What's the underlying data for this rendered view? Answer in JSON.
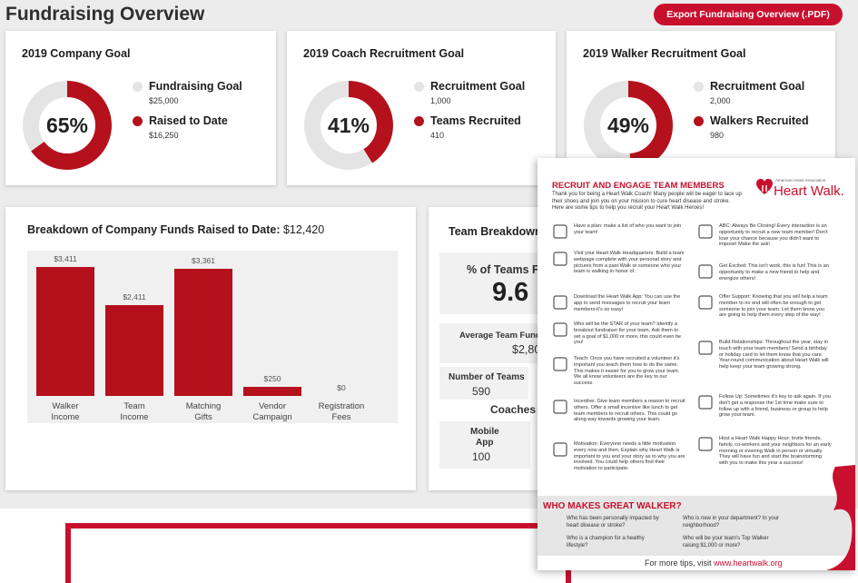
{
  "page": {
    "title": "Fundraising Overview",
    "export_label": "Export Fundraising Overview (.PDF)"
  },
  "goals": [
    {
      "title": "2019 Company Goal",
      "percent_label": "65%",
      "percent": 0.65,
      "goal_label": "Fundraising Goal",
      "goal_value": "$25,000",
      "done_label": "Raised to Date",
      "done_value": "$16,250"
    },
    {
      "title": "2019 Coach Recruitment Goal",
      "percent_label": "41%",
      "percent": 0.41,
      "goal_label": "Recruitment Goal",
      "goal_value": "1,000",
      "done_label": "Teams Recruited",
      "done_value": "410"
    },
    {
      "title": "2019 Walker Recruitment Goal",
      "percent_label": "49%",
      "percent": 0.49,
      "goal_label": "Recruitment Goal",
      "goal_value": "2,000",
      "done_label": "Walkers Recruited",
      "done_value": "980"
    }
  ],
  "breakdown": {
    "title_prefix": "Breakdown of Company Funds Raised to Date: ",
    "title_total": "$12,420"
  },
  "chart_data": {
    "type": "bar",
    "title": "Breakdown of Company Funds Raised to Date: $12,420",
    "categories": [
      "Walker Income",
      "Team Income",
      "Matching Gifts",
      "Vendor Campaign",
      "Registration Fees"
    ],
    "category_lines": [
      [
        "Walker",
        "Income"
      ],
      [
        "Team",
        "Income"
      ],
      [
        "Matching",
        "Gifts"
      ],
      [
        "Vendor",
        "Campaign"
      ],
      [
        "Registration",
        "Fees"
      ]
    ],
    "values": [
      3411,
      2411,
      3361,
      250,
      0
    ],
    "value_labels": [
      "$3,411",
      "$2,411",
      "$3,361",
      "$250",
      "$0"
    ],
    "ylim": [
      0,
      3600
    ],
    "grid": false,
    "bar_color": "#b4111d"
  },
  "team_breakdown": {
    "title": "Team Breakdown",
    "pct_label": "% of Teams Fu",
    "pct_value": "9.6",
    "avg_label": "Average Team Fundr",
    "avg_value": "$2,80",
    "num_teams_label": "Number of Teams",
    "num_teams_value": "590",
    "coaches_label": "Coaches",
    "mobile_label_1": "Mobile",
    "mobile_label_2": "App",
    "mobile_value": "100"
  },
  "flyer": {
    "heading": "RECRUIT AND ENGAGE TEAM MEMBERS",
    "intro": "Thank you for being a Heart Walk Coach! Many people will be eager to lace up their shoes and join you on your mission to cure heart disease and stroke. Here are some tips to help you recruit your Heart Walk Heroes!",
    "logo_small": "American Heart Association.",
    "logo_big": "Heart Walk.",
    "tips_left": [
      "Have a plan: make a list of who you want to join your team!",
      "Visit your Heart Walk Headquarters: Build a team webpage complete with your personal story and pictures from a past Walk or someone who your team is walking in honor of.",
      "Download the Heart Walk App: You can use the app to send messages to recruit your team members-it's so easy!",
      "Who will be the STAR of your team? Identify a breakout fundraiser for your team. Ask them to set a goal of $1,000 or more, this could even be you!",
      "Teach: Once you have recruited a volunteer it's important you teach them how to do the same. This makes it easier for you to grow your team. We all know volunteers are the key to our success.",
      "Incentive: Give team members a reason to recruit others. Offer a small incentive like lunch to get team members to recruit others. This could go along way towards growing your team.",
      "Motivation: Everyone needs a little motivation every now and then. Explain why Heart Walk is important to you and your story as to why you are involved. You could help others find their motivation to participate."
    ],
    "tips_right": [
      "ABC: Always Be Closing! Every interaction is an opportunity to recruit a new team member! Don't lose your chance because you didn't want to impose! Make the ask!",
      "Get Excited: This isn't work, this is fun! This is an opportunity to make a new friend to help and energize others!",
      "Offer Support: Knowing that you will help a team member to no end will often be enough to get someone to join your team. Let them know you are going to help them every step of the way!",
      "Build Relationships: Throughout the year, stay in touch with your team members! Send a birthday or holiday card to let them know that you care. Year-round communication about Heart Walk will help keep your team growing strong.",
      "Follow Up: Sometimes it's key to ask again. If you don't get a response the 1st time make sure to follow up with a friend, business or group to help grow your team.",
      "Host a Heart Walk Happy Hour: Invite friends, family, co-workers and your neighbors for an early morning or evening Walk in person or virtually. They will have fun and start the brainstorming with you to make this year a success!"
    ],
    "band_title": "WHO MAKES GREAT WALKER?",
    "band_items": [
      "Who has been personally impacted by heart disease or stroke?",
      "Who is a champion for a healthy lifestyle?",
      "Who is new in your department? In your neighborhood?",
      "Who will be your team's Top Walker raising $1,000 or more?"
    ],
    "footer_prefix": "For more tips, visit ",
    "footer_link": "www.heartwalk.org"
  },
  "colors": {
    "brand_red": "#c8102e",
    "bar_red": "#b4111d",
    "track_gray": "#e4e4e4"
  }
}
